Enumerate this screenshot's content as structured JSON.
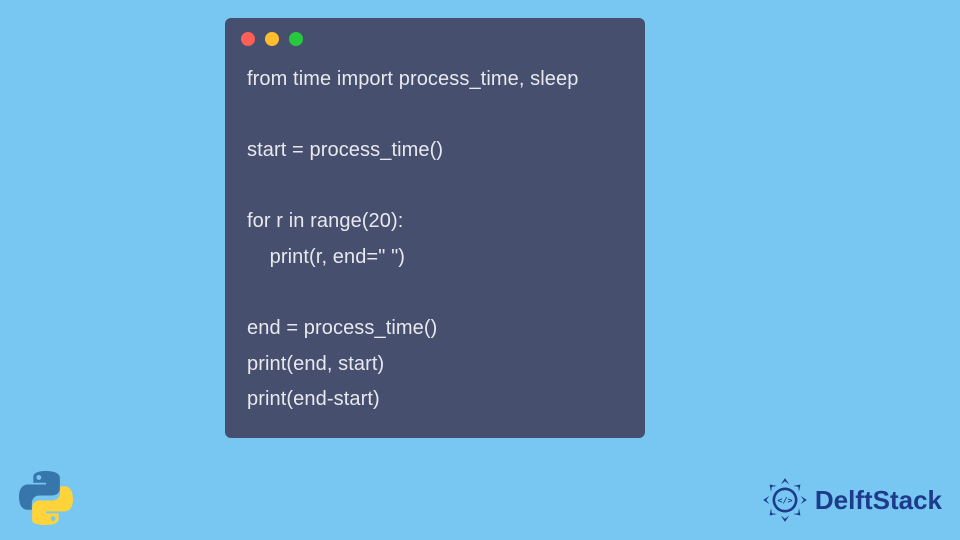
{
  "code": {
    "lines": [
      "from time import process_time, sleep",
      "",
      "start = process_time()",
      "",
      "for r in range(20):",
      "    print(r, end=\" \")",
      "",
      "end = process_time()",
      "print(end, start)",
      "print(end-start)"
    ]
  },
  "brand": {
    "name": "DelftStack"
  }
}
